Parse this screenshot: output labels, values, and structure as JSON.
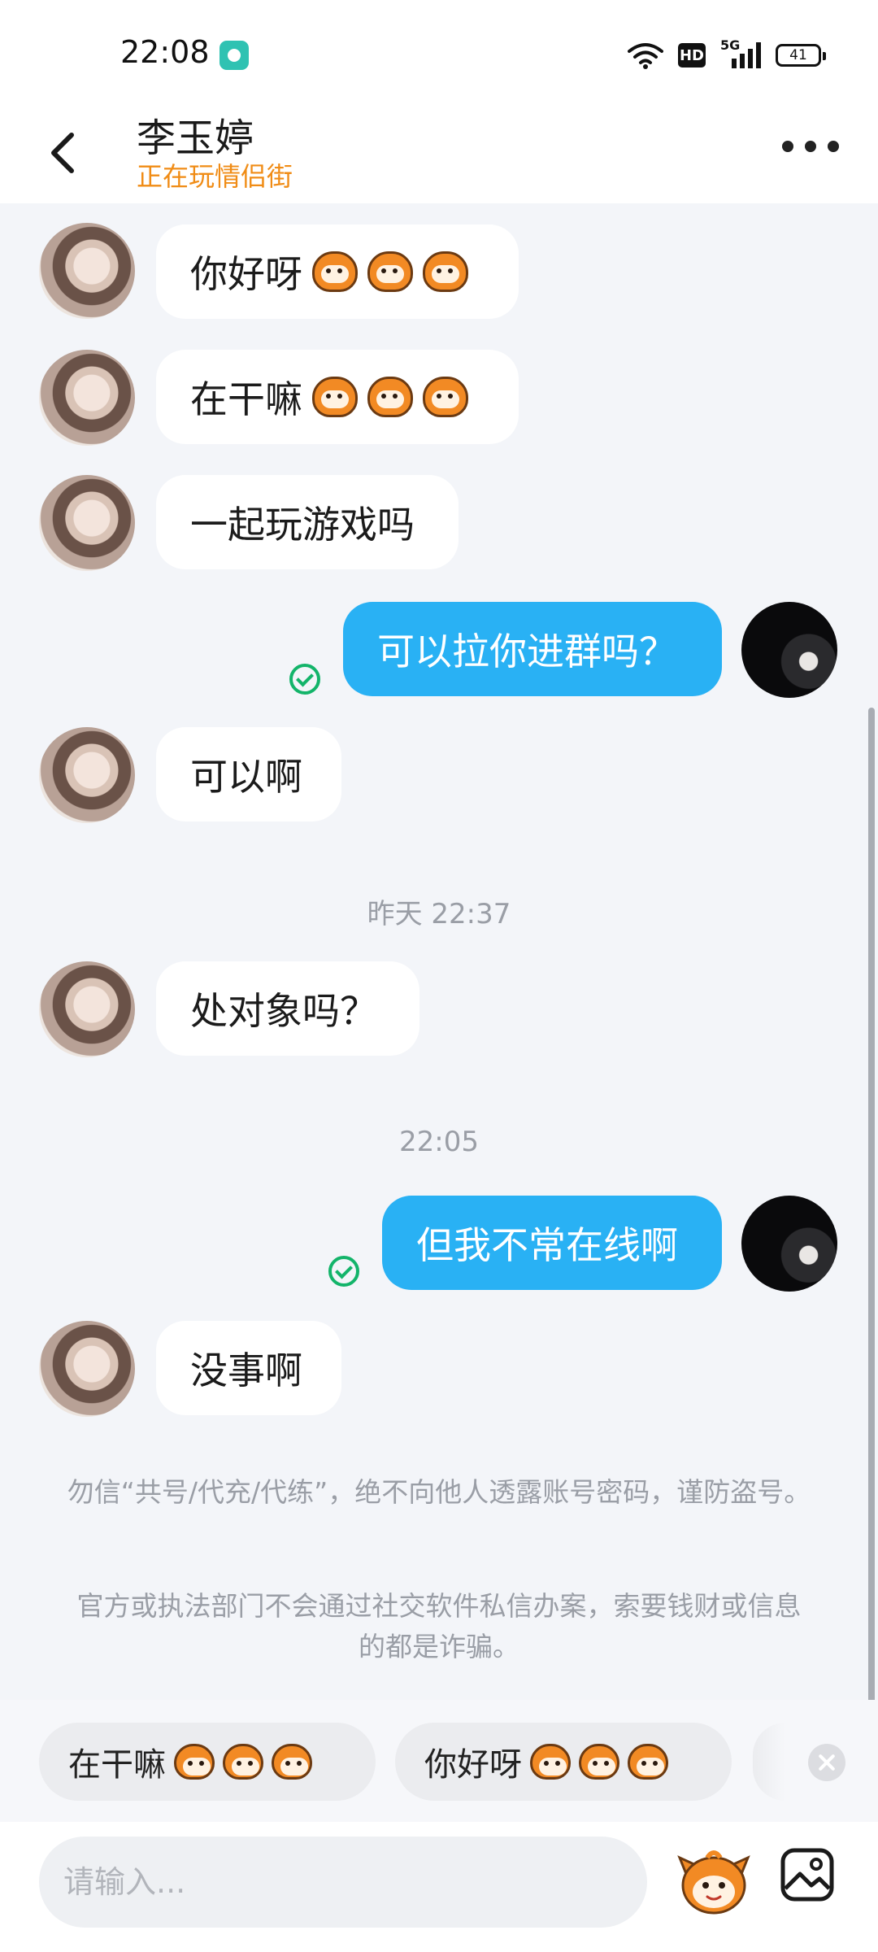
{
  "status_bar": {
    "time": "22:08",
    "network": "5G",
    "hd": "HD",
    "battery": "41"
  },
  "header": {
    "title": "李玉婷",
    "subtitle": "正在玩情侣街"
  },
  "messages": [
    {
      "side": "in",
      "text": "你好呀",
      "emojis": 3
    },
    {
      "side": "in",
      "text": "在干嘛",
      "emojis": 3
    },
    {
      "side": "in",
      "text": "一起玩游戏吗"
    },
    {
      "side": "out",
      "text": "可以拉你进群吗？",
      "read": true
    },
    {
      "side": "in",
      "text": "可以啊"
    },
    {
      "side": "in",
      "text": "处对象吗？"
    },
    {
      "side": "out",
      "text": "但我不常在线啊",
      "read": true
    },
    {
      "side": "in",
      "text": "没事啊"
    }
  ],
  "timestamps": [
    "昨天 22:37",
    "22:05"
  ],
  "notices": [
    "勿信“共号/代充/代练”，绝不向他人透露账号密码，谨防盗号。",
    "官方或执法部门不会通过社交软件私信办案，索要钱财或信息的都是诈骗。"
  ],
  "quick_replies": [
    {
      "text": "在干嘛",
      "emojis": 3
    },
    {
      "text": "你好呀",
      "emojis": 3
    }
  ],
  "input": {
    "placeholder": "请输入..."
  },
  "icons": {
    "back": "back-arrow-icon",
    "more": "more-dots-icon",
    "read": "read-check-icon",
    "close": "close-icon",
    "emoji": "mascot-emoji-icon",
    "image": "image-icon"
  },
  "colors": {
    "accent": "#29b1f4",
    "subtitle": "#f08c16",
    "read_check": "#13b46a",
    "background": "#f3f5f9"
  }
}
